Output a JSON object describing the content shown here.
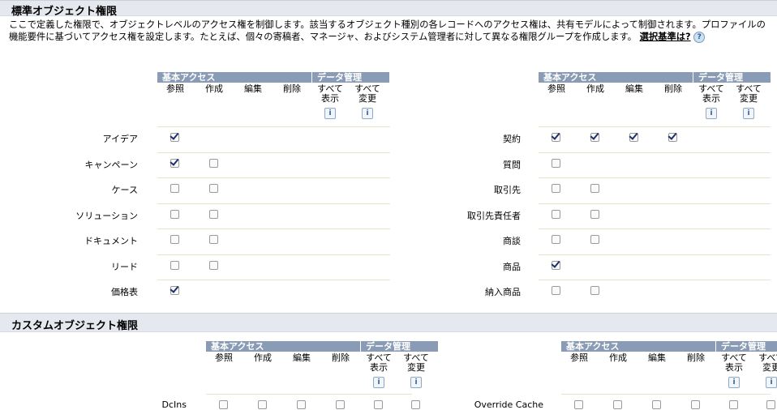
{
  "standard": {
    "title": "標準オブジェクト権限",
    "description": "ここで定義した権限で、オブジェクトレベルのアクセス権を制御します。該当するオブジェクト種別の各レコードへのアクセス権は、共有モデルによって制御されます。プロファイルの機能要件に基づいてアクセス権を設定します。たとえば、個々の寄稿者、マネージャ、およびシステム管理者に対して異なる権限グループを作成します。",
    "link": "選択基準は?",
    "headers": {
      "basic": "基本アクセス",
      "data_mgmt": "データ管理",
      "read": "参照",
      "create": "作成",
      "edit": "編集",
      "delete": "削除",
      "view_all_1": "すべて",
      "view_all_2": "表示",
      "modify_all_1": "すべて",
      "modify_all_2": "変更",
      "info": "i"
    },
    "left": [
      {
        "label": "アイデア",
        "checks": [
          true,
          null,
          null,
          null
        ]
      },
      {
        "label": "キャンペーン",
        "checks": [
          true,
          false,
          null,
          null
        ]
      },
      {
        "label": "ケース",
        "checks": [
          false,
          false,
          null,
          null
        ]
      },
      {
        "label": "ソリューション",
        "checks": [
          false,
          false,
          null,
          null
        ]
      },
      {
        "label": "ドキュメント",
        "checks": [
          false,
          false,
          null,
          null
        ]
      },
      {
        "label": "リード",
        "checks": [
          false,
          false,
          null,
          null
        ]
      },
      {
        "label": "価格表",
        "checks": [
          true,
          null,
          null,
          null
        ]
      }
    ],
    "right": [
      {
        "label": "契約",
        "checks": [
          true,
          true,
          true,
          true
        ]
      },
      {
        "label": "質問",
        "checks": [
          false,
          null,
          null,
          null
        ]
      },
      {
        "label": "取引先",
        "checks": [
          false,
          false,
          null,
          null
        ]
      },
      {
        "label": "取引先責任者",
        "checks": [
          false,
          false,
          null,
          null
        ]
      },
      {
        "label": "商談",
        "checks": [
          false,
          false,
          null,
          null
        ]
      },
      {
        "label": "商品",
        "checks": [
          true,
          null,
          null,
          null
        ]
      },
      {
        "label": "納入商品",
        "checks": [
          false,
          false,
          null,
          null
        ]
      }
    ]
  },
  "custom": {
    "title": "カスタムオブジェクト権限",
    "left": [
      {
        "label": "DcIns"
      }
    ],
    "right": [
      {
        "label": "Override Cache"
      }
    ]
  }
}
